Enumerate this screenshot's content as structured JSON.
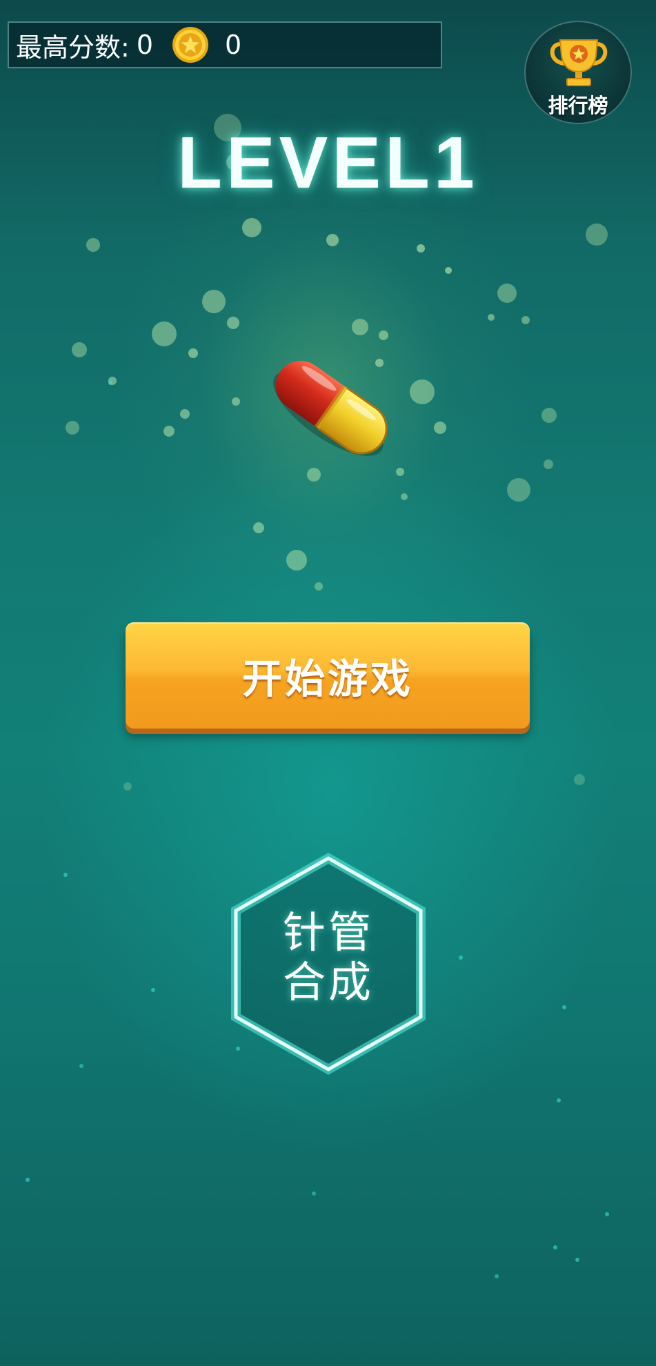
{
  "header": {
    "score_label": "最高分数:",
    "score_value": "0",
    "coin_icon": "star-coin-icon",
    "coin_value": "0"
  },
  "leaderboard": {
    "label": "排行榜",
    "icon": "trophy-icon"
  },
  "level": {
    "title": "LEVEL1"
  },
  "hero": {
    "icon": "capsule-pill-icon"
  },
  "start_button": {
    "label": "开始游戏"
  },
  "merge_button": {
    "line1": "针管",
    "line2": "合成"
  },
  "colors": {
    "background": "#127a73",
    "start_button": "#fdb833",
    "pill_red": "#d42b1c",
    "pill_yellow": "#f2d02a",
    "hex_glow": "#9ff5ec"
  }
}
